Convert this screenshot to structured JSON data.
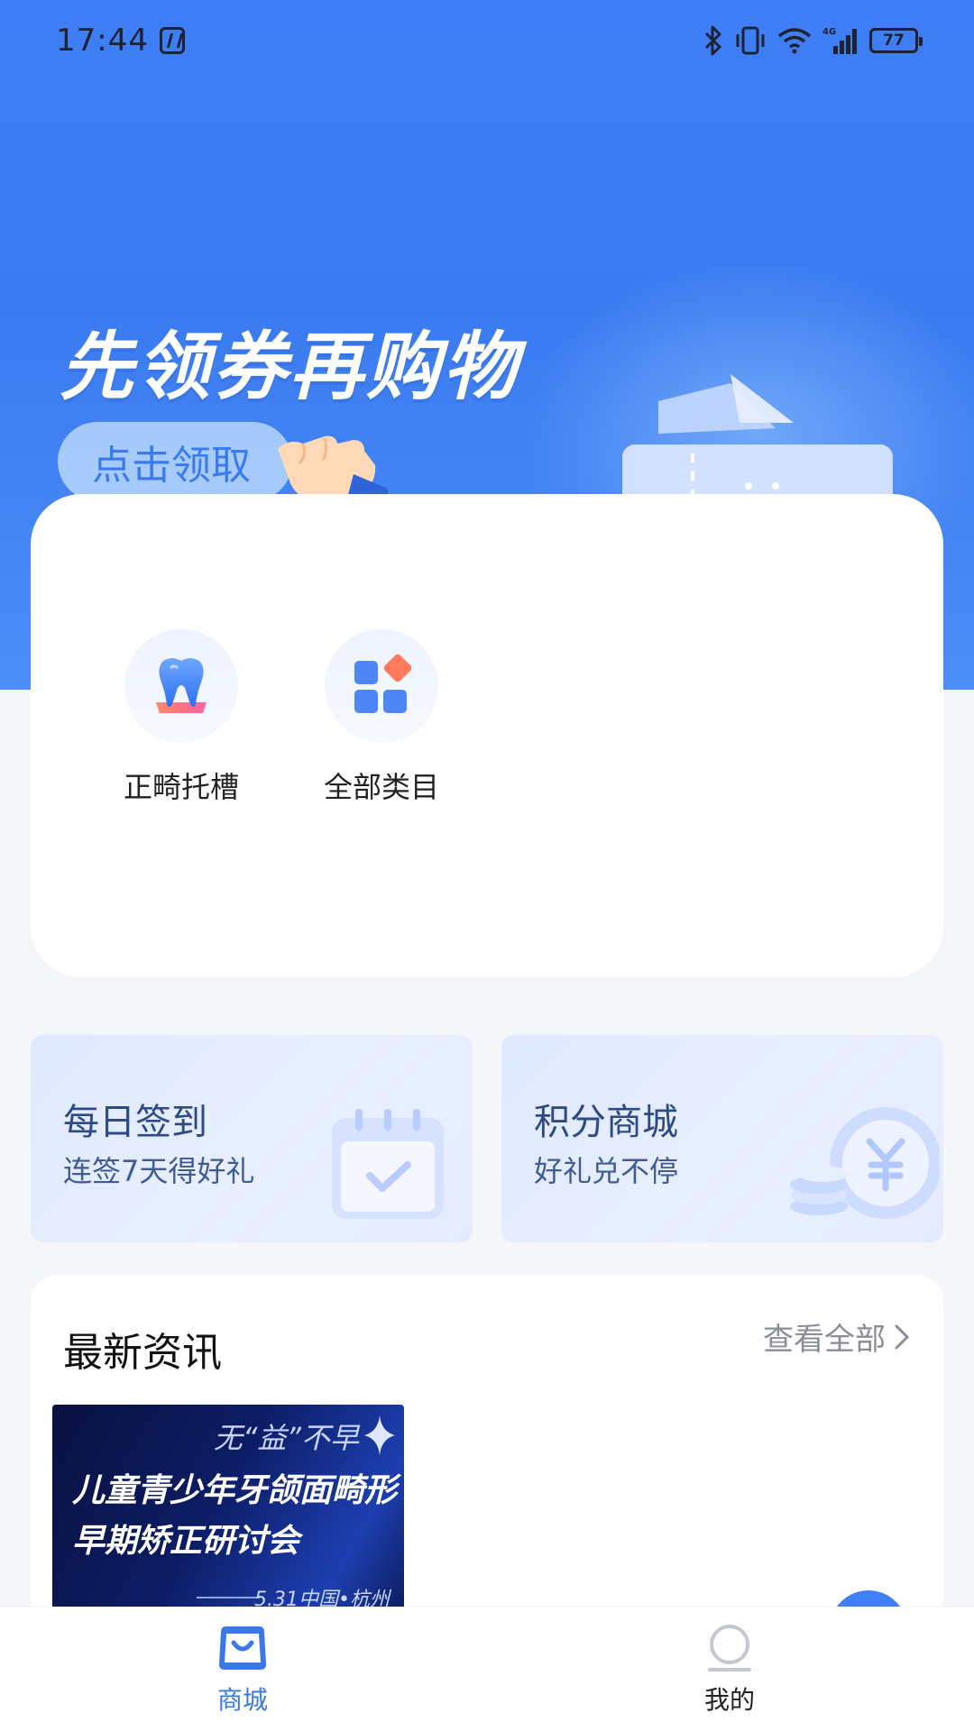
{
  "status_bar": {
    "time": "17:44",
    "battery": "77"
  },
  "hero": {
    "title": "先领券再购物",
    "claim_button": "点击领取"
  },
  "categories": [
    {
      "label": "正畸托槽",
      "icon": "tooth-icon"
    },
    {
      "label": "全部类目",
      "icon": "grid-icon"
    }
  ],
  "promos": {
    "checkin": {
      "title": "每日签到",
      "subtitle": "连签7天得好礼",
      "icon": "calendar-icon"
    },
    "points_mall": {
      "title": "积分商城",
      "subtitle": "好礼兑不停",
      "icon": "yuan-coin-icon"
    }
  },
  "news": {
    "title": "最新资讯",
    "view_all": "查看全部",
    "banner": {
      "tagline": "无“益”不早",
      "line1": "儿童青少年牙颌面畸形",
      "line2": "早期矫正研讨会",
      "info": "5.31中国•杭州"
    }
  },
  "tabs": [
    {
      "label": "商城",
      "icon": "shop-bag-icon",
      "active": true
    },
    {
      "label": "我的",
      "icon": "profile-icon",
      "active": false
    }
  ],
  "colors": {
    "brand": "#3f7ef6",
    "active_tab": "#3a78e8",
    "inactive_tab": "#222222"
  }
}
